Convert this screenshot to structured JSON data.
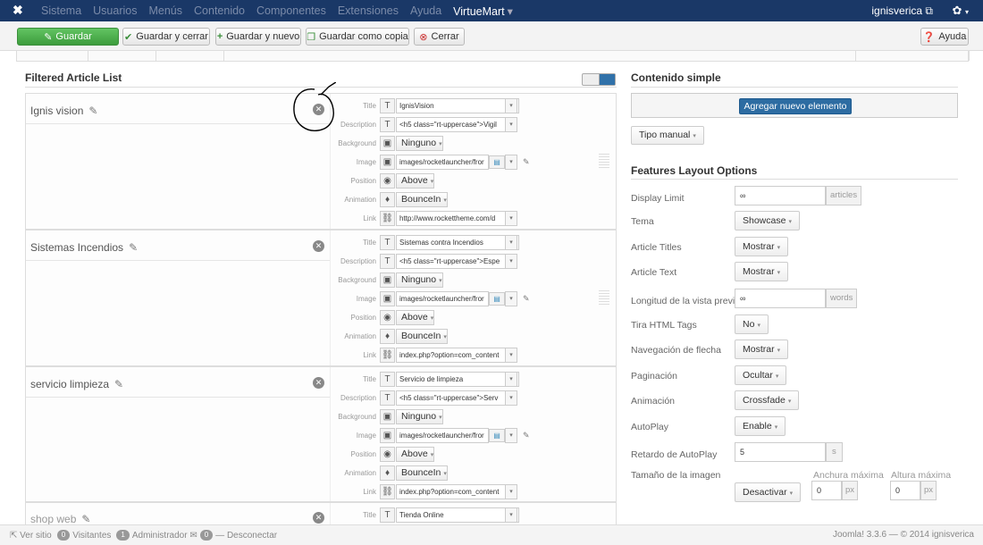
{
  "topbar": {
    "menu": [
      "Sistema",
      "Usuarios",
      "Menús",
      "Contenido",
      "Componentes",
      "Extensiones",
      "Ayuda",
      "VirtueMart"
    ],
    "user": "ignisverica"
  },
  "toolbar": {
    "save": "Guardar",
    "save_close": "Guardar y cerrar",
    "save_new": "Guardar y nuevo",
    "save_copy": "Guardar como copia",
    "close": "Cerrar",
    "help": "Ayuda"
  },
  "left": {
    "title": "Filtered Article List",
    "field_labels": {
      "title": "Title",
      "description": "Description",
      "background": "Background",
      "image": "Image",
      "position": "Position",
      "animation": "Animation",
      "link": "Link"
    },
    "items": [
      {
        "name": "Ignis vision",
        "title": "IgnisVision",
        "description": "<h5 class=\"rt-uppercase\">Vigil",
        "background": "Ninguno",
        "image": "images/rocketlauncher/fror",
        "position": "Above",
        "animation": "BounceIn",
        "link": "http://www.rockettheme.com/d"
      },
      {
        "name": "Sistemas Incendios",
        "title": "Sistemas contra Incendios",
        "description": "<h5 class=\"rt-uppercase\">Espe",
        "background": "Ninguno",
        "image": "images/rocketlauncher/fror",
        "position": "Above",
        "animation": "BounceIn",
        "link": "index.php?option=com_content"
      },
      {
        "name": "servicio limpieza",
        "title": "Servicio de limpieza",
        "description": "<h5 class=\"rt-uppercase\">Serv",
        "background": "Ninguno",
        "image": "images/rocketlauncher/fror",
        "position": "Above",
        "animation": "BounceIn",
        "link": "index.php?option=com_content"
      },
      {
        "name": "shop web",
        "title": "Tienda Online"
      }
    ]
  },
  "right": {
    "content_title": "Contenido simple",
    "add_button": "Agregar nuevo elemento",
    "manual_type": "Tipo manual",
    "features_title": "Features Layout Options",
    "options": {
      "display_limit": {
        "label": "Display Limit",
        "value": "∞",
        "addon": "articles"
      },
      "tema": {
        "label": "Tema",
        "value": "Showcase"
      },
      "article_titles": {
        "label": "Article Titles",
        "value": "Mostrar"
      },
      "article_text": {
        "label": "Article Text",
        "value": "Mostrar"
      },
      "preview_length": {
        "label": "Longitud de la vista previa",
        "value": "∞",
        "addon": "words"
      },
      "strip_html": {
        "label": "Tira HTML Tags",
        "value": "No"
      },
      "arrow_nav": {
        "label": "Navegación de flecha",
        "value": "Mostrar"
      },
      "pagination": {
        "label": "Paginación",
        "value": "Ocultar"
      },
      "animation": {
        "label": "Animación",
        "value": "Crossfade"
      },
      "autoplay": {
        "label": "AutoPlay",
        "value": "Enable"
      },
      "autoplay_delay": {
        "label": "Retardo de AutoPlay",
        "value": "5",
        "addon": "s"
      },
      "image_size": {
        "label": "Tamaño de la imagen",
        "value": "Desactivar",
        "max_width_label": "Anchura máxima",
        "max_width": "0",
        "max_height_label": "Altura máxima",
        "max_height": "0",
        "addon": "px"
      }
    }
  },
  "footer": {
    "site": "Ver sitio",
    "visitors_count": "0",
    "visitors": "Visitantes",
    "admin_count": "1",
    "admin": "Administrador",
    "msg_count": "0",
    "logout": "Desconectar",
    "version": "Joomla! 3.3.6 — © 2014 ignisverica"
  },
  "colors": {
    "topbar": "#1a3867",
    "save_green": "#4cae4c",
    "primary_blue": "#2d6ca2"
  }
}
